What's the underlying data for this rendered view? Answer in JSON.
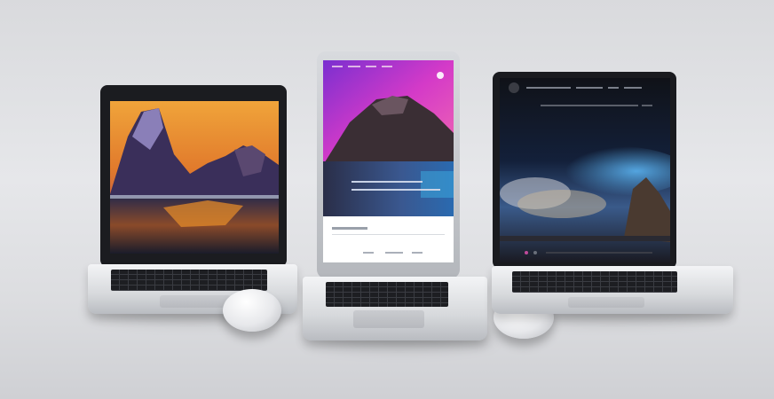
{
  "scene": {
    "description_label": "",
    "colors": {
      "background": "#e2e3e6",
      "laptop_body": "#d7d9dc",
      "bezel": "#1b1c20",
      "left_sky_top": "#f2a23a",
      "middle_sky": "#c42fc9",
      "right_glow": "#3a86c9"
    }
  },
  "devices": [
    {
      "name": "left-laptop",
      "icon": "laptop-icon"
    },
    {
      "name": "center-tablet-laptop",
      "icon": "laptop-icon"
    },
    {
      "name": "right-laptop",
      "icon": "laptop-icon"
    }
  ],
  "peripherals": [
    {
      "name": "left-mouse",
      "icon": "mouse-icon"
    },
    {
      "name": "right-mouse",
      "icon": "mouse-icon"
    }
  ]
}
